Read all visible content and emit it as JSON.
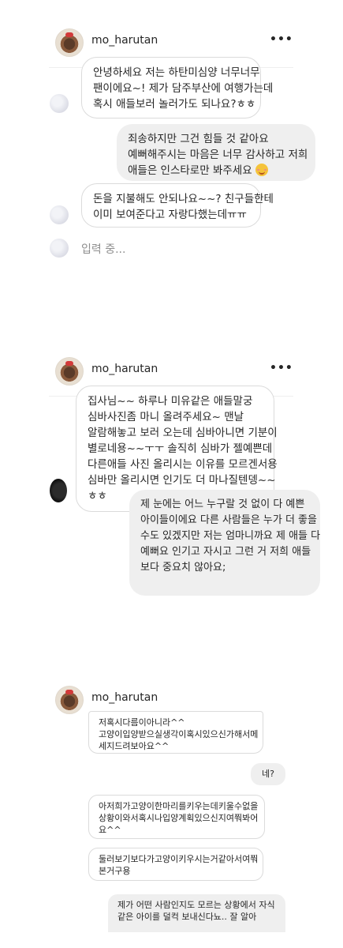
{
  "panels": [
    {
      "username": "mo_harutan",
      "messages": [
        {
          "dir": "in",
          "lines": [
            "안녕하세요 저는 하탄미심양 너무너무",
            "팬이에요~! 제가 담주부산에 여행가는데",
            "혹시 애들보러 놀러가도 되나요?ㅎㅎ"
          ]
        },
        {
          "dir": "out",
          "lines": [
            "죄송하지만 그건 힘들 것 같아요",
            "예뻐해주시는 마음은 너무 감사하고 저희",
            "애들은 인스타로만 봐주세요"
          ]
        },
        {
          "dir": "in",
          "lines": [
            "돈을 지불해도 안되나요~~? 친구들한테",
            "이미 보여준다고 자랑다했는데ㅠㅠ"
          ]
        }
      ],
      "typing": "입력 중..."
    },
    {
      "username": "mo_harutan",
      "messages": [
        {
          "dir": "in",
          "lines": [
            "집사님~~ 하루나 미유같은 애들말궁",
            "심바사진좀 마니 올려주세요~ 맨날",
            "알람해놓고 보러 오는데 심바아니면 기분이",
            "별로네용~~ㅜㅜ 솔직히 심바가 젤예쁜데",
            "다른애들 사진 올리시는 이유를 모르겐서용",
            "심바만 올리시면 인기도 더 마나질텐뎅~~",
            "ㅎㅎ"
          ]
        },
        {
          "dir": "out",
          "lines": [
            "제 눈에는 어느 누구랄 것 없이 다 예쁜",
            "아이들이에요 다른 사람들은 누가 더 좋을",
            "수도 있겠지만 저는 엄마니까요 제 애들 다",
            "예뻐요 인기고 자시고 그런 거 저희 애들",
            "보다 중요치 않아요;"
          ]
        }
      ]
    },
    {
      "username": "mo_harutan",
      "messages": [
        {
          "dir": "in",
          "lines": [
            "저혹시다름이아니라^^",
            "고양이입양받으실생각이혹시있으신가해서메",
            "세지드려보아요^^"
          ]
        },
        {
          "dir": "out",
          "lines": [
            "네?"
          ]
        },
        {
          "dir": "in",
          "lines": [
            "아저희가고양이한마리를키우는데키울수없을",
            "상황이와서혹시나입양계획있으신지여쭤봐어",
            "요^^"
          ]
        },
        {
          "dir": "in",
          "lines": [
            "둘러보기보다가고양이키우시는거같아서여쭤",
            "본거구용"
          ]
        },
        {
          "dir": "out",
          "lines": [
            "제가 어떤 사람인지도 모르는 상황에서 자식",
            "같은 아이를 덜컥 보내신다뇨.. 잘 알아"
          ]
        }
      ]
    }
  ],
  "icons": {
    "avatar": "profile-photo",
    "more": "more-options-icon",
    "smile": "smiling-face-emoji"
  }
}
